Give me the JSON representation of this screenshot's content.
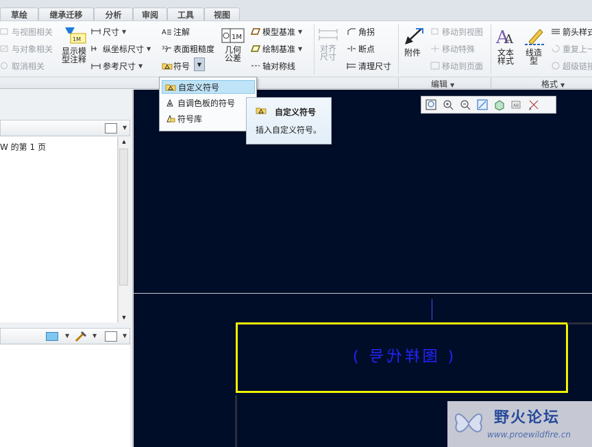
{
  "tabs": [
    "草绘",
    "继承迁移",
    "分析",
    "审阅",
    "工具",
    "视图"
  ],
  "ribbon": {
    "assoc": [
      "与视图相关",
      "与对象相关",
      "取消相关"
    ],
    "show_model_annot": "显示模型注释",
    "dimension": "尺寸",
    "ordinate_dim": "纵坐标尺寸",
    "ref_dim": "参考尺寸",
    "note": "注解",
    "surface_finish": "表面粗糙度",
    "symbol": "符号",
    "geom_tol": "几何公差",
    "model_datum": "模型基准",
    "draw_datum": "绘制基准",
    "axis_sym": "轴对称线",
    "align_dim": "对齐尺寸",
    "corner": "角拐",
    "breakpoint": "断点",
    "clean_dim": "清理尺寸",
    "attach": "附件",
    "move_to_view": "移动到视图",
    "move_special": "移动特殊",
    "move_to_page": "移动到页面",
    "text_style": "文本样式",
    "line_style": "线造型",
    "arrow_style": "箭头样式",
    "repeat_last": "重复上一",
    "hyperlink": "超级链接",
    "group_edit": "编辑",
    "group_format": "格式"
  },
  "dropdown": {
    "items": [
      "自定义符号",
      "自调色板的符号",
      "符号库"
    ]
  },
  "tooltip": {
    "title": "自定义符号",
    "desc": "插入自定义符号。"
  },
  "left_panel": {
    "page_text": "W 的第 1 页"
  },
  "canvas": {
    "mirrored_text": "( 图样代号 )"
  },
  "watermark": {
    "title": "野火论坛",
    "url": "www.proewildfire.cn"
  },
  "colors": {
    "canvas_bg": "#000d28",
    "frame": "#f4f400",
    "text_blue": "#2323ff"
  }
}
